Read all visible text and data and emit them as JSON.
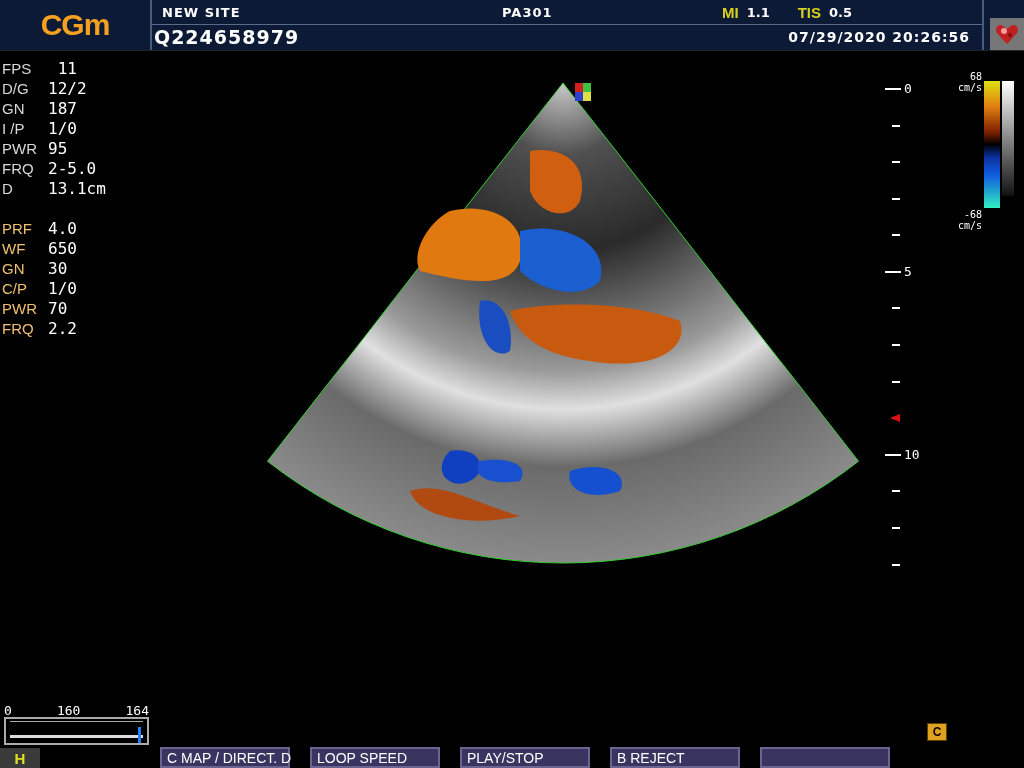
{
  "header": {
    "logo": "CGm",
    "site": "NEW SITE",
    "probe": "PA301",
    "mi_label": "MI",
    "mi_value": "1.1",
    "tis_label": "TIS",
    "tis_value": "0.5",
    "patient_id": "Q224658979",
    "datetime": "07/29/2020 20:26:56"
  },
  "parameters": [
    {
      "kind": "bmode",
      "label": "FPS",
      "value": " 11"
    },
    {
      "kind": "bmode",
      "label": "D/G",
      "value": "12/2"
    },
    {
      "kind": "bmode",
      "label": "GN",
      "value": "187"
    },
    {
      "kind": "bmode",
      "label": "I /P",
      "value": "1/0"
    },
    {
      "kind": "bmode",
      "label": "PWR",
      "value": "95"
    },
    {
      "kind": "bmode",
      "label": "FRQ",
      "value": "2-5.0"
    },
    {
      "kind": "bmode",
      "label": "D",
      "value": "13.1cm"
    },
    {
      "kind": "color",
      "label": "PRF",
      "value": "4.0"
    },
    {
      "kind": "color",
      "label": "WF",
      "value": "650"
    },
    {
      "kind": "color",
      "label": "GN",
      "value": "30"
    },
    {
      "kind": "color",
      "label": "C/P",
      "value": "1/0"
    },
    {
      "kind": "color",
      "label": "PWR",
      "value": "70"
    },
    {
      "kind": "color",
      "label": "FRQ",
      "value": "2.2"
    }
  ],
  "depth_labels": [
    {
      "label": "0"
    },
    {
      "label": "5"
    },
    {
      "label": "10"
    }
  ],
  "color_scale": {
    "max": "68",
    "max_unit": "cm/s",
    "min": "-68",
    "min_unit": "cm/s"
  },
  "cine": {
    "start": "0",
    "current": "160",
    "end": "164",
    "level": 0.98
  },
  "mode_indicator": "H",
  "cine_badge": "C",
  "softkeys": [
    {
      "kind": "labeled",
      "label": "C MAP / DIRECT. D"
    },
    {
      "kind": "labeled",
      "label": "LOOP SPEED"
    },
    {
      "kind": "labeled",
      "label": "PLAY/STOP"
    },
    {
      "kind": "labeled",
      "label": "B REJECT"
    },
    {
      "kind": "blank"
    }
  ]
}
